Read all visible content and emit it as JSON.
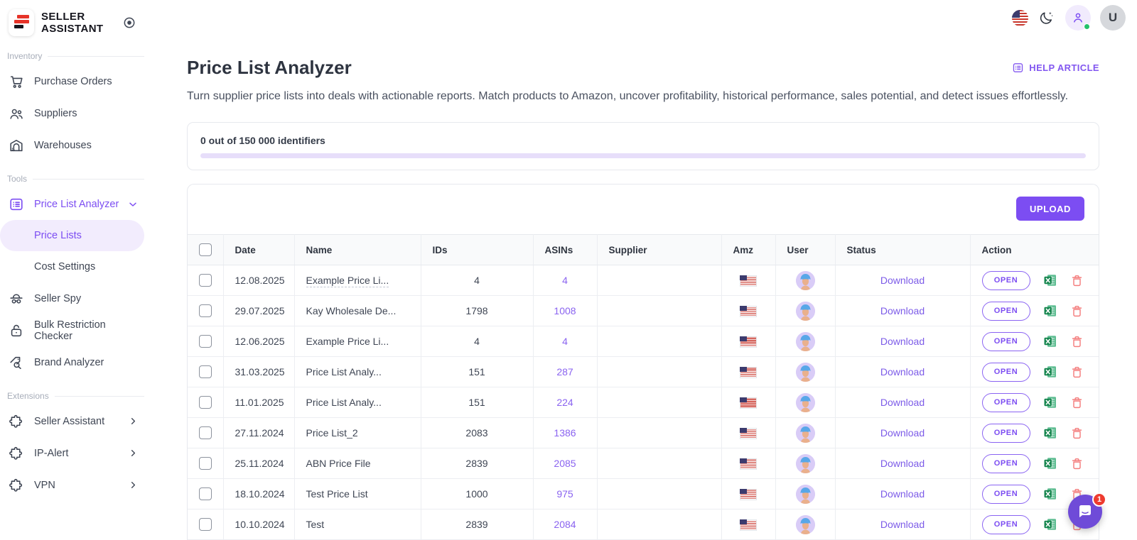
{
  "colors": {
    "accent": "#7c4df2",
    "link": "#7c5be8",
    "asin_link": "#8a63f0",
    "progress_track": "#e7defa",
    "danger": "#f47c7c",
    "excel_green": "#1e8a5e"
  },
  "brand": {
    "name": "SELLER\nASSISTANT"
  },
  "sidebar": {
    "sections": [
      {
        "label": "Inventory",
        "items": [
          {
            "label": "Purchase Orders",
            "icon": "cart-icon"
          },
          {
            "label": "Suppliers",
            "icon": "people-icon"
          },
          {
            "label": "Warehouses",
            "icon": "warehouse-icon"
          }
        ]
      },
      {
        "label": "Tools",
        "items": [
          {
            "label": "Price List Analyzer",
            "icon": "price-list-icon",
            "expanded": true
          },
          {
            "label": "Price Lists",
            "sub": true,
            "selected": true
          },
          {
            "label": "Cost Settings",
            "sub": true
          },
          {
            "label": "Seller Spy",
            "icon": "spy-icon"
          },
          {
            "label": "Bulk Restriction Checker",
            "icon": "lock-icon"
          },
          {
            "label": "Brand Analyzer",
            "icon": "tag-search-icon"
          }
        ]
      },
      {
        "label": "Extensions",
        "items": [
          {
            "label": "Seller Assistant",
            "icon": "puzzle-icon"
          },
          {
            "label": "IP-Alert",
            "icon": "puzzle-icon"
          },
          {
            "label": "VPN",
            "icon": "puzzle-icon"
          }
        ]
      }
    ]
  },
  "topbar": {
    "avatar_letter": "U"
  },
  "page": {
    "title": "Price List Analyzer",
    "help_link": "HELP ARTICLE",
    "subtitle": "Turn supplier price lists into deals with actionable reports. Match products to Amazon, uncover profitability, historical performance, sales potential, and detect issues effortlessly."
  },
  "quota": {
    "text": "0 out of 150 000 identifiers",
    "progress_pct": 0
  },
  "table": {
    "upload_label": "UPLOAD",
    "columns": [
      "Date",
      "Name",
      "IDs",
      "ASINs",
      "Supplier",
      "Amz",
      "User",
      "Status",
      "Action"
    ],
    "download_label": "Download",
    "open_label": "OPEN",
    "rows": [
      {
        "date": "12.08.2025",
        "name": "Example Price Li...",
        "ids": "4",
        "asins": "4",
        "supplier": "",
        "name_tooltip_underline": true
      },
      {
        "date": "29.07.2025",
        "name": "Kay Wholesale De...",
        "ids": "1798",
        "asins": "1008",
        "supplier": ""
      },
      {
        "date": "12.06.2025",
        "name": "Example Price Li...",
        "ids": "4",
        "asins": "4",
        "supplier": ""
      },
      {
        "date": "31.03.2025",
        "name": "Price List Analy...",
        "ids": "151",
        "asins": "287",
        "supplier": ""
      },
      {
        "date": "11.01.2025",
        "name": "Price List Analy...",
        "ids": "151",
        "asins": "224",
        "supplier": ""
      },
      {
        "date": "27.11.2024",
        "name": "Price List_2",
        "ids": "2083",
        "asins": "1386",
        "supplier": ""
      },
      {
        "date": "25.11.2024",
        "name": "ABN Price File",
        "ids": "2839",
        "asins": "2085",
        "supplier": ""
      },
      {
        "date": "18.10.2024",
        "name": "Test Price List",
        "ids": "1000",
        "asins": "975",
        "supplier": ""
      },
      {
        "date": "10.10.2024",
        "name": "Test",
        "ids": "2839",
        "asins": "2084",
        "supplier": ""
      }
    ]
  },
  "chat": {
    "badge": "1"
  }
}
